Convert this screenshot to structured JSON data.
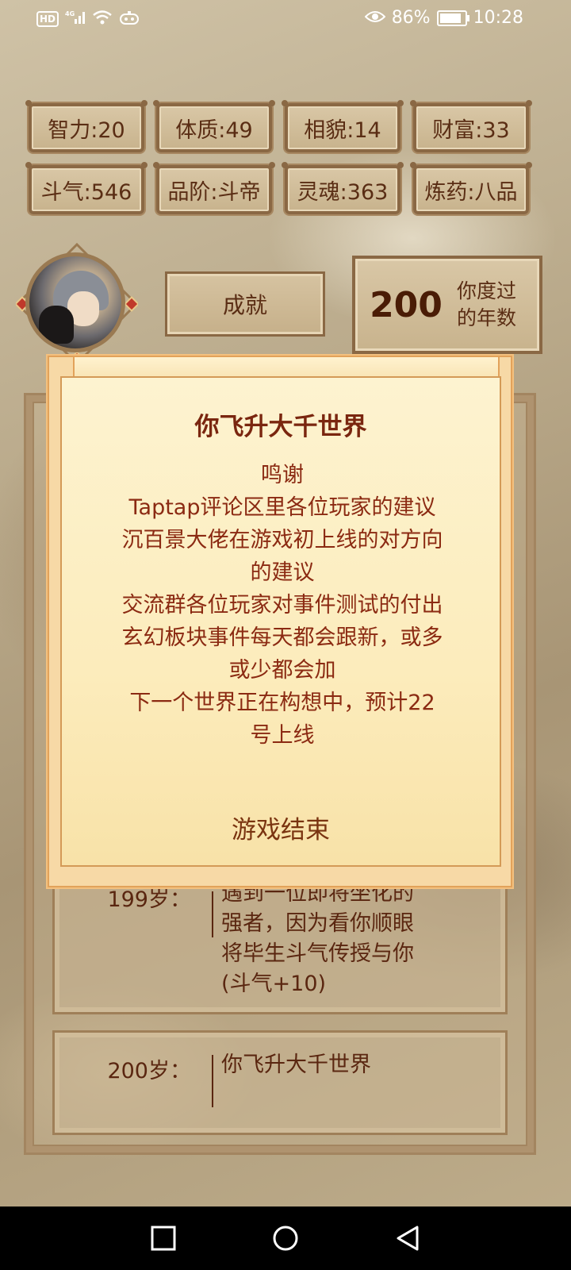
{
  "status_bar": {
    "hd": "HD",
    "network": "4G",
    "battery_percent": "86%",
    "battery_level": 0.86,
    "time": "10:28"
  },
  "stats": [
    {
      "label": "智力:20"
    },
    {
      "label": "体质:49"
    },
    {
      "label": "相貌:14"
    },
    {
      "label": "财富:33"
    },
    {
      "label": "斗气:546"
    },
    {
      "label": "品阶:斗帝"
    },
    {
      "label": "灵魂:363"
    },
    {
      "label": "炼药:八品"
    }
  ],
  "achievements_button": "成就",
  "years": {
    "value": "200",
    "label": "你度过\n的年数"
  },
  "log": [
    {
      "age": "199岁：",
      "lines": [
        "遇到一位即将坐化的",
        "强者，因为看你顺眼",
        "将毕生斗气传授与你",
        "(斗气+10)"
      ]
    },
    {
      "age": "200岁：",
      "lines": [
        "你飞升大千世界"
      ]
    }
  ],
  "modal": {
    "title": "你飞升大千世界",
    "lines": [
      "鸣谢",
      "Taptap评论区里各位玩家的建议",
      "沉百景大佬在游戏初上线的对方向",
      "的建议",
      "交流群各位玩家对事件测试的付出",
      "玄幻板块事件每天都会跟新，或多",
      "或少都会加",
      "下一个世界正在构想中，预计22",
      "号上线"
    ],
    "end_button": "游戏结束"
  },
  "colors": {
    "accent": "#8b2a12",
    "frame": "#8a6844",
    "modal_bg": "#fcecbc"
  }
}
